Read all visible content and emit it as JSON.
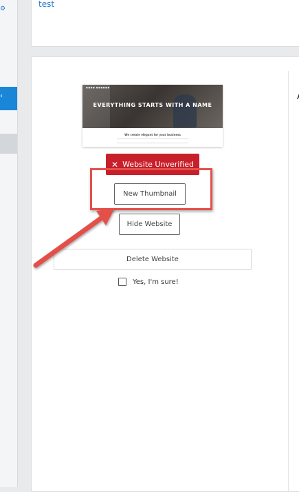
{
  "sidebar": {
    "top_icon": "settings-icon",
    "active_item_icon": "chevron-icon"
  },
  "top_panel": {
    "link_text": "test"
  },
  "right_column": {
    "letter": "A"
  },
  "thumbnail": {
    "headline": "EVERYTHING STARTS WITH A NAME",
    "subheadline": "We create elegant for your business"
  },
  "actions": {
    "unverified_label": "Website Unverified",
    "new_thumbnail_label": "New Thumbnail",
    "hide_website_label": "Hide Website",
    "delete_website_label": "Delete Website",
    "confirm_label": "Yes, I'm sure!"
  },
  "colors": {
    "accent_blue": "#1a86d8",
    "danger_red": "#c8202b",
    "annotation_red": "#e4504a"
  }
}
